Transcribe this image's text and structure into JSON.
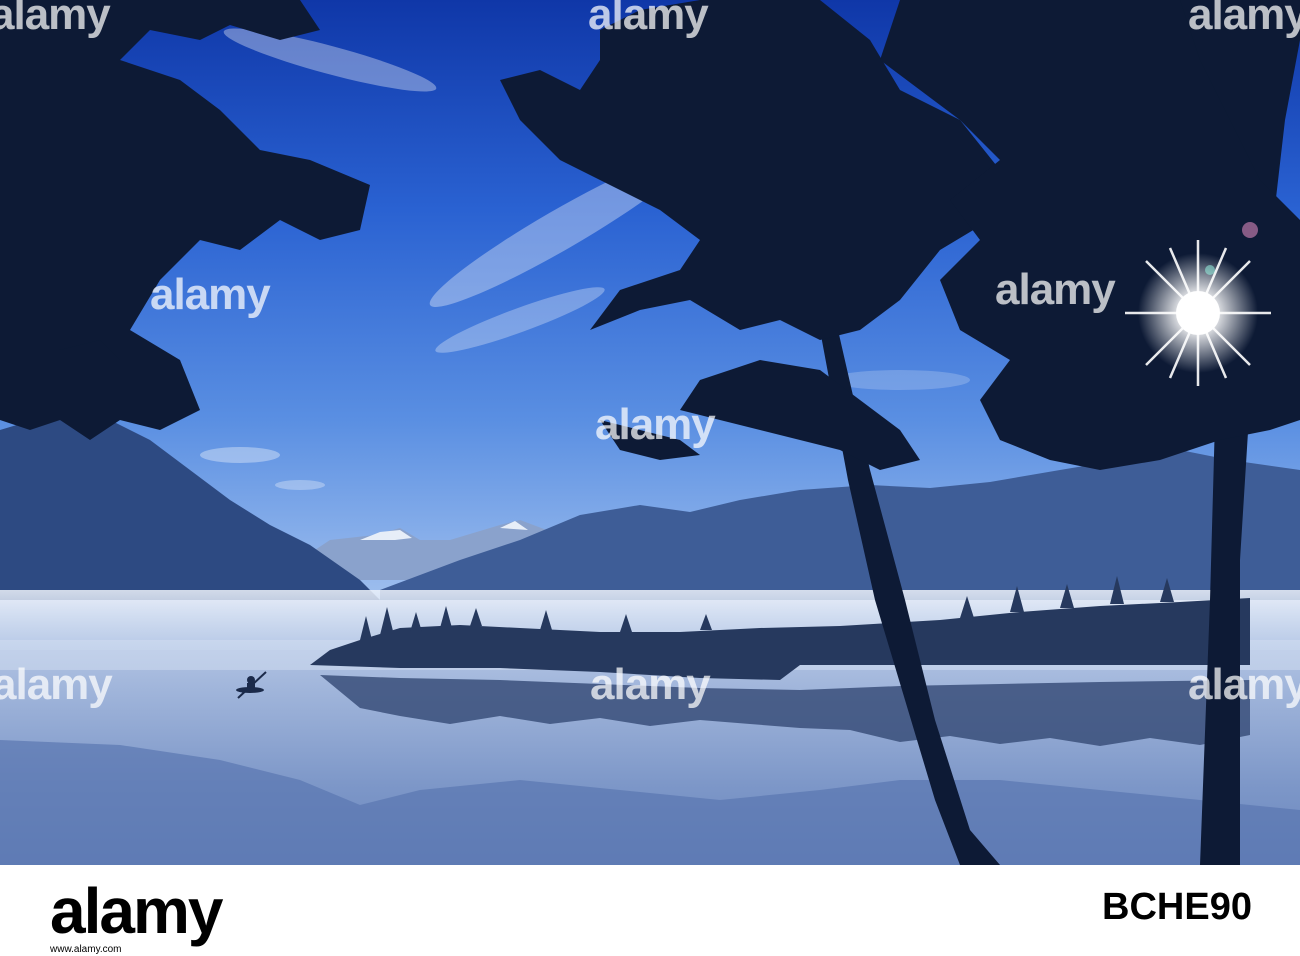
{
  "photo": {
    "watermark_text": "alamy",
    "palette": {
      "sky_top": "#1440b8",
      "sky_mid": "#2f68d4",
      "sky_low": "#7aa6e8",
      "mist": "#d7e3f3",
      "water": "#8ea6cf",
      "silhouette": "#0e1b33"
    }
  },
  "footer": {
    "logo": "alamy",
    "image_id": "BCHE90",
    "url": "www.alamy.com"
  }
}
